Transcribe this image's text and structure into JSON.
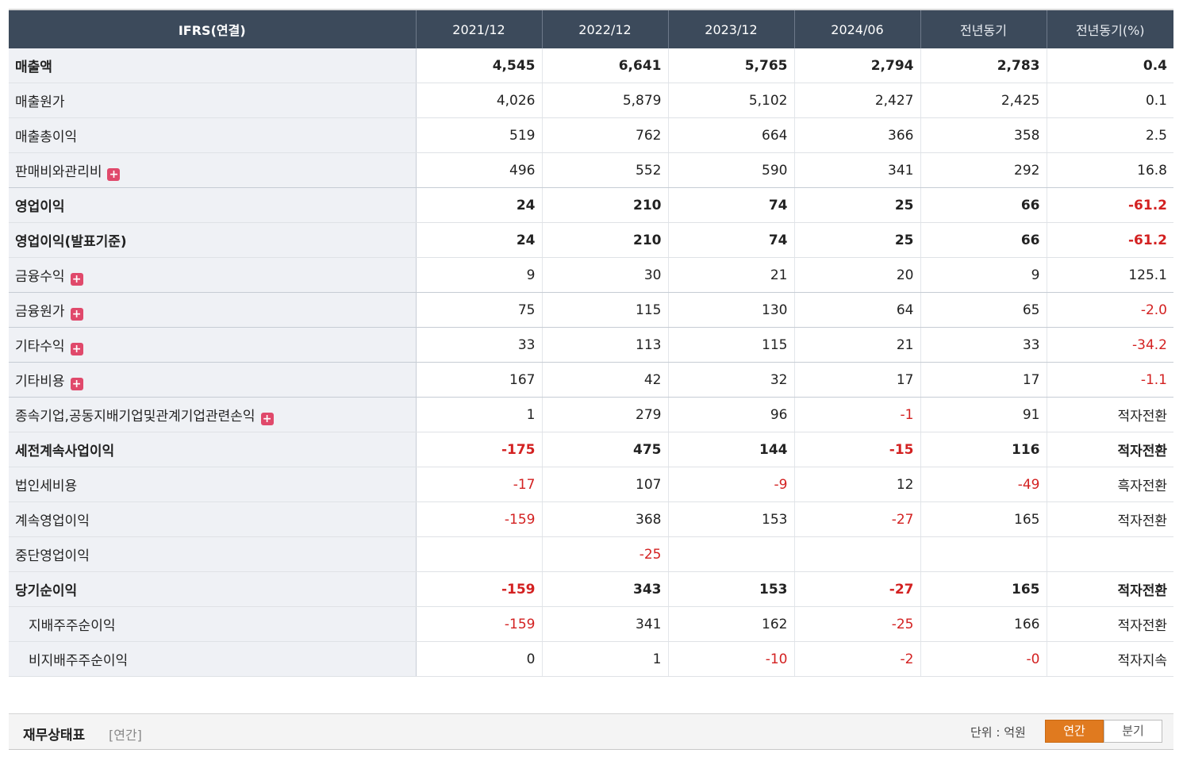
{
  "table": {
    "headers": [
      "IFRS(연결)",
      "2021/12",
      "2022/12",
      "2023/12",
      "2024/06",
      "전년동기",
      "전년동기(%)"
    ],
    "rows": [
      {
        "label": "매출액",
        "bold": true,
        "expand": false,
        "indent": false,
        "values": [
          "4,545",
          "6,641",
          "5,765",
          "2,794",
          "2,783",
          "0.4"
        ]
      },
      {
        "label": "매출원가",
        "bold": false,
        "expand": false,
        "indent": false,
        "values": [
          "4,026",
          "5,879",
          "5,102",
          "2,427",
          "2,425",
          "0.1"
        ]
      },
      {
        "label": "매출총이익",
        "bold": false,
        "expand": false,
        "indent": false,
        "values": [
          "519",
          "762",
          "664",
          "366",
          "358",
          "2.5"
        ]
      },
      {
        "label": "판매비와관리비",
        "bold": false,
        "expand": true,
        "indent": false,
        "values": [
          "496",
          "552",
          "590",
          "341",
          "292",
          "16.8"
        ]
      },
      {
        "label": "영업이익",
        "bold": true,
        "expand": false,
        "indent": false,
        "values": [
          "24",
          "210",
          "74",
          "25",
          "66",
          "-61.2"
        ]
      },
      {
        "label": "영업이익(발표기준)",
        "bold": true,
        "expand": false,
        "indent": false,
        "values": [
          "24",
          "210",
          "74",
          "25",
          "66",
          "-61.2"
        ]
      },
      {
        "label": "금융수익",
        "bold": false,
        "expand": true,
        "indent": false,
        "values": [
          "9",
          "30",
          "21",
          "20",
          "9",
          "125.1"
        ]
      },
      {
        "label": "금융원가",
        "bold": false,
        "expand": true,
        "indent": false,
        "values": [
          "75",
          "115",
          "130",
          "64",
          "65",
          "-2.0"
        ]
      },
      {
        "label": "기타수익",
        "bold": false,
        "expand": true,
        "indent": false,
        "values": [
          "33",
          "113",
          "115",
          "21",
          "33",
          "-34.2"
        ]
      },
      {
        "label": "기타비용",
        "bold": false,
        "expand": true,
        "indent": false,
        "values": [
          "167",
          "42",
          "32",
          "17",
          "17",
          "-1.1"
        ]
      },
      {
        "label": "종속기업,공동지배기업및관계기업관련손익",
        "bold": false,
        "expand": true,
        "indent": false,
        "values": [
          "1",
          "279",
          "96",
          "-1",
          "91",
          "적자전환"
        ]
      },
      {
        "label": "세전계속사업이익",
        "bold": true,
        "expand": false,
        "indent": false,
        "values": [
          "-175",
          "475",
          "144",
          "-15",
          "116",
          "적자전환"
        ]
      },
      {
        "label": "법인세비용",
        "bold": false,
        "expand": false,
        "indent": false,
        "values": [
          "-17",
          "107",
          "-9",
          "12",
          "-49",
          "흑자전환"
        ]
      },
      {
        "label": "계속영업이익",
        "bold": false,
        "expand": false,
        "indent": false,
        "values": [
          "-159",
          "368",
          "153",
          "-27",
          "165",
          "적자전환"
        ]
      },
      {
        "label": "중단영업이익",
        "bold": false,
        "expand": false,
        "indent": false,
        "values": [
          "",
          "-25",
          "",
          "",
          "",
          ""
        ]
      },
      {
        "label": "당기순이익",
        "bold": true,
        "expand": false,
        "indent": false,
        "values": [
          "-159",
          "343",
          "153",
          "-27",
          "165",
          "적자전환"
        ]
      },
      {
        "label": "지배주주순이익",
        "bold": false,
        "expand": false,
        "indent": true,
        "values": [
          "-159",
          "341",
          "162",
          "-25",
          "166",
          "적자전환"
        ]
      },
      {
        "label": "비지배주주순이익",
        "bold": false,
        "expand": false,
        "indent": true,
        "values": [
          "0",
          "1",
          "-10",
          "-2",
          "-0",
          "적자지속"
        ]
      }
    ]
  },
  "section": {
    "title": "재무상태표",
    "subtitle": "[연간]",
    "unit": "단위 : 억원",
    "toggle_annual": "연간",
    "toggle_quarter": "분기",
    "active": "연간"
  },
  "colors": {
    "header_bg": "#3c4a5b",
    "negative": "#d32121",
    "toggle_active": "#e07a1f",
    "expand_icon": "#e0496b"
  },
  "icons": {
    "expand": "plus-box-icon",
    "expand_glyph": "+"
  }
}
